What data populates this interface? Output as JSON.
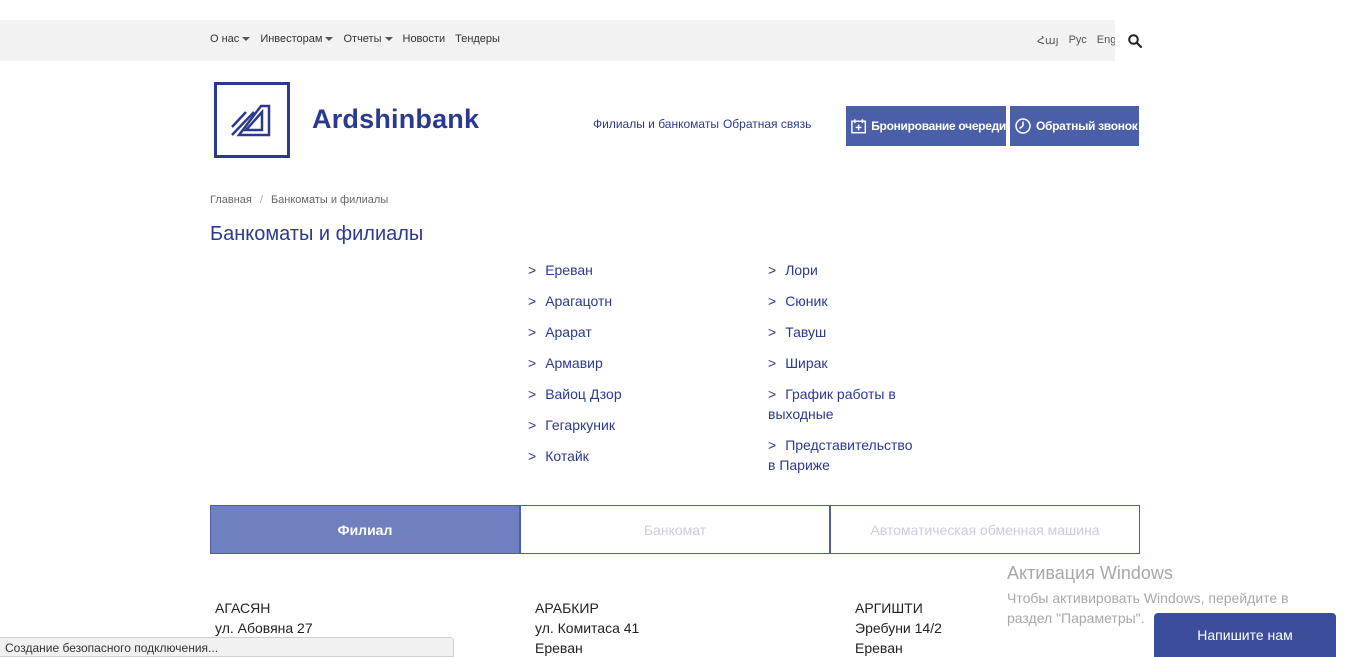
{
  "topnav": {
    "items": [
      {
        "label": "О нас",
        "dropdown": true
      },
      {
        "label": "Инвесторам",
        "dropdown": true
      },
      {
        "label": "Отчеты",
        "dropdown": true
      },
      {
        "label": "Новости",
        "dropdown": false
      },
      {
        "label": "Тендеры",
        "dropdown": false
      }
    ],
    "langs": [
      "Հայ",
      "Рус",
      "Eng"
    ]
  },
  "header": {
    "brand": "Ardshinbank",
    "links": [
      "Филиалы и банкоматы",
      "Обратная связь"
    ],
    "queue_button": "Бронирование очереди",
    "callback_button": "Обратный звонок"
  },
  "breadcrumb": {
    "home": "Главная",
    "separator": "/",
    "current": "Банкоматы и филиалы"
  },
  "page_title": "Банкоматы и филиалы",
  "regions": {
    "col1": [
      "Ереван",
      "Арагацотн",
      "Арарат",
      "Армавир",
      "Вайоц Дзор",
      "Гегаркуник",
      "Котайк"
    ],
    "col2": [
      "Лори",
      "Сюник",
      "Тавуш",
      "Ширак"
    ],
    "col2_wrapped": [
      {
        "line1": "График работы в",
        "line2": "выходные"
      },
      {
        "line1": "Представительство",
        "line2": "в Париже"
      }
    ],
    "marker": ">"
  },
  "tabs": [
    {
      "label": "Филиал",
      "active": true
    },
    {
      "label": "Банкомат",
      "active": false
    },
    {
      "label": "Автоматическая обменная машина",
      "active": false
    }
  ],
  "branches": [
    {
      "name": "АГАСЯН",
      "address": "ул. Абовяна 27",
      "city": ""
    },
    {
      "name": "АРАБКИР",
      "address": "ул. Комитаса 41",
      "city": "Ереван"
    },
    {
      "name": "АРГИШТИ",
      "address": "Эребуни 14/2",
      "city": "Ереван"
    }
  ],
  "watermark": {
    "title": "Активация Windows",
    "line1": "Чтобы активировать Windows, перейдите в",
    "line2": "раздел \"Параметры\"."
  },
  "chat_button": "Напишите нам",
  "status_bar": "Создание безопасного подключения...",
  "colors": {
    "brand": "#2b3990",
    "button": "#4b5ea8",
    "active_tab": "#6e80bf"
  }
}
